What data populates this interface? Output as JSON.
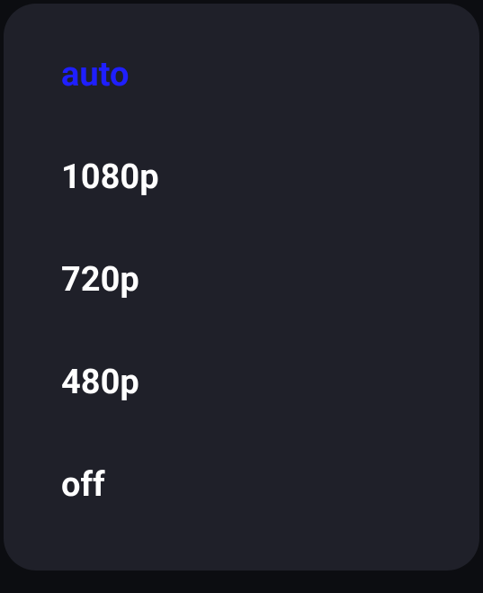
{
  "quality_menu": {
    "options": [
      {
        "label": "auto",
        "selected": true
      },
      {
        "label": "1080p",
        "selected": false
      },
      {
        "label": "720p",
        "selected": false
      },
      {
        "label": "480p",
        "selected": false
      },
      {
        "label": "off",
        "selected": false
      }
    ]
  },
  "colors": {
    "background": "#0c0d11",
    "panel": "#1f2029",
    "text": "#ffffff",
    "selected": "#1f1fff"
  }
}
